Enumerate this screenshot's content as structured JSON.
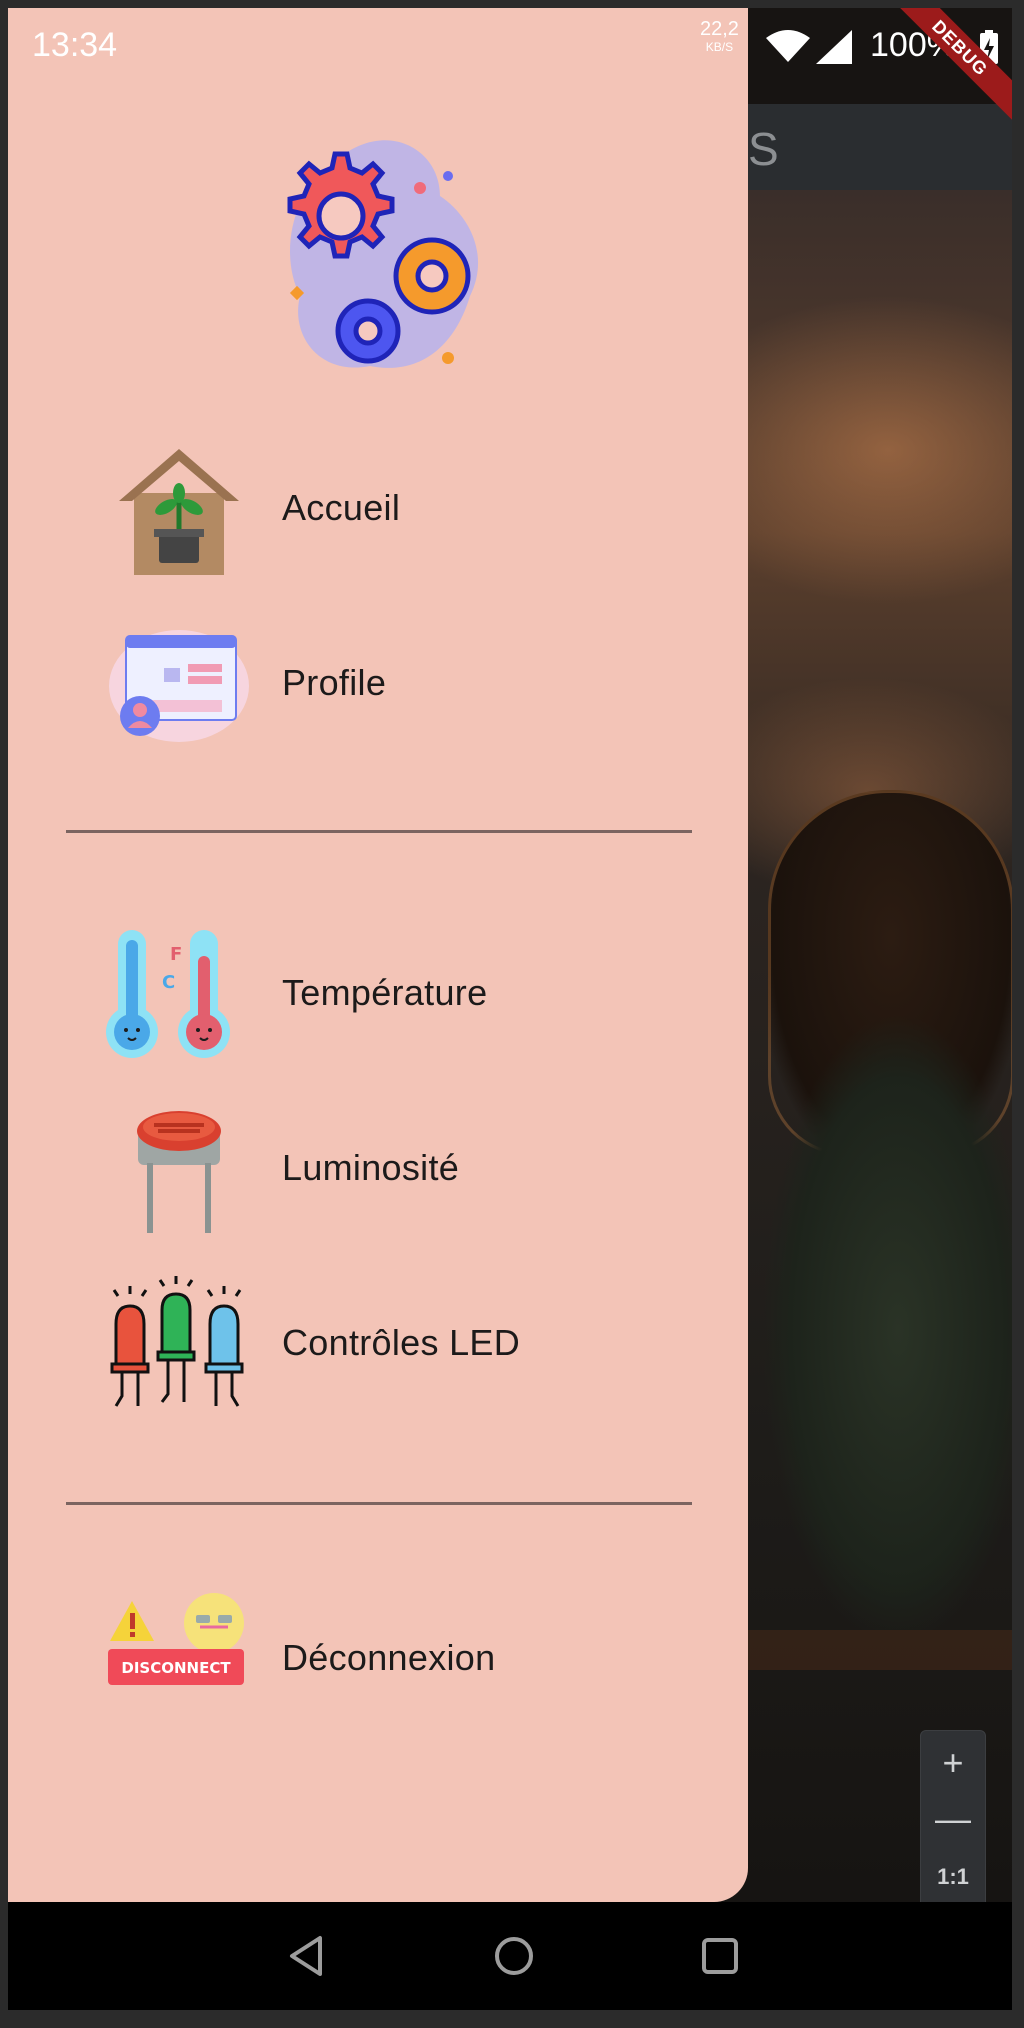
{
  "status_bar": {
    "time": "13:34",
    "net_speed": "22,2",
    "net_unit": "KB/S",
    "battery": "100%"
  },
  "debug_banner": "DEBUG",
  "background_app": {
    "title_fragment": "S"
  },
  "drawer": {
    "header_icon": "gears-icon",
    "sections": [
      [
        {
          "label": "Accueil",
          "icon": "house-plant-icon"
        },
        {
          "label": "Profile",
          "icon": "profile-window-icon"
        }
      ],
      [
        {
          "label": "Température",
          "icon": "thermometers-icon"
        },
        {
          "label": "Luminosité",
          "icon": "photoresistor-icon"
        },
        {
          "label": "Contrôles LED",
          "icon": "leds-icon"
        }
      ],
      [
        {
          "label": "Déconnexion",
          "icon": "disconnect-icon",
          "badge_text": "DISCONNECT"
        }
      ]
    ]
  },
  "zoom_controls": {
    "zoom_in": "+",
    "zoom_out": "—",
    "reset": "1:1"
  },
  "colors": {
    "drawer_bg": "#f3c4b7",
    "divider": "#7b6460",
    "debug_ribbon": "#9c1b1b"
  }
}
